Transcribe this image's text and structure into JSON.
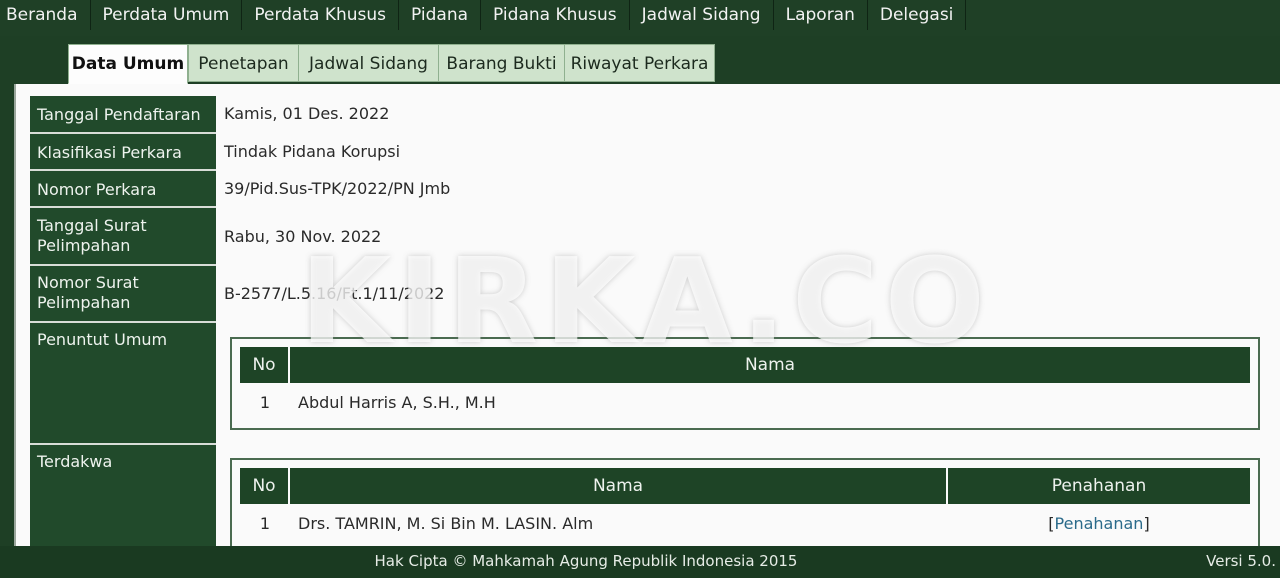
{
  "nav": {
    "items": [
      "Beranda",
      "Perdata Umum",
      "Perdata Khusus",
      "Pidana",
      "Pidana Khusus",
      "Jadwal Sidang",
      "Laporan",
      "Delegasi"
    ]
  },
  "tabs": [
    "Data Umum",
    "Penetapan",
    "Jadwal Sidang",
    "Barang Bukti",
    "Riwayat Perkara"
  ],
  "fields": {
    "tanggal_pendaftaran": {
      "label": "Tanggal Pendaftaran",
      "value": "Kamis, 01 Des. 2022"
    },
    "klasifikasi": {
      "label": "Klasifikasi Perkara",
      "value": "Tindak Pidana Korupsi"
    },
    "nomor_perkara": {
      "label": "Nomor Perkara",
      "value": "39/Pid.Sus-TPK/2022/PN Jmb"
    },
    "tanggal_surat": {
      "label": "Tanggal Surat Pelimpahan",
      "value": "Rabu, 30 Nov. 2022"
    },
    "nomor_surat": {
      "label": "Nomor Surat Pelimpahan",
      "value": "B-2577/L.5.16/Ft.1/11/2022"
    },
    "penuntut_umum": {
      "label": "Penuntut Umum"
    },
    "terdakwa": {
      "label": "Terdakwa"
    }
  },
  "penuntut_table": {
    "headers": {
      "no": "No",
      "nama": "Nama"
    },
    "rows": [
      {
        "no": "1",
        "nama": "Abdul Harris A, S.H., M.H"
      }
    ]
  },
  "terdakwa_table": {
    "headers": {
      "no": "No",
      "nama": "Nama",
      "penahanan": "Penahanan"
    },
    "rows": [
      {
        "no": "1",
        "nama": "Drs. TAMRIN, M. Si Bin M. LASIN. Alm",
        "penahanan_open": "[",
        "penahanan_link": "Penahanan",
        "penahanan_close": "]"
      }
    ]
  },
  "watermark": "KIRKA.CO",
  "footer": {
    "copyright": "Hak Cipta © Mahkamah Agung Republik Indonesia 2015",
    "version": "Versi 5.0."
  }
}
